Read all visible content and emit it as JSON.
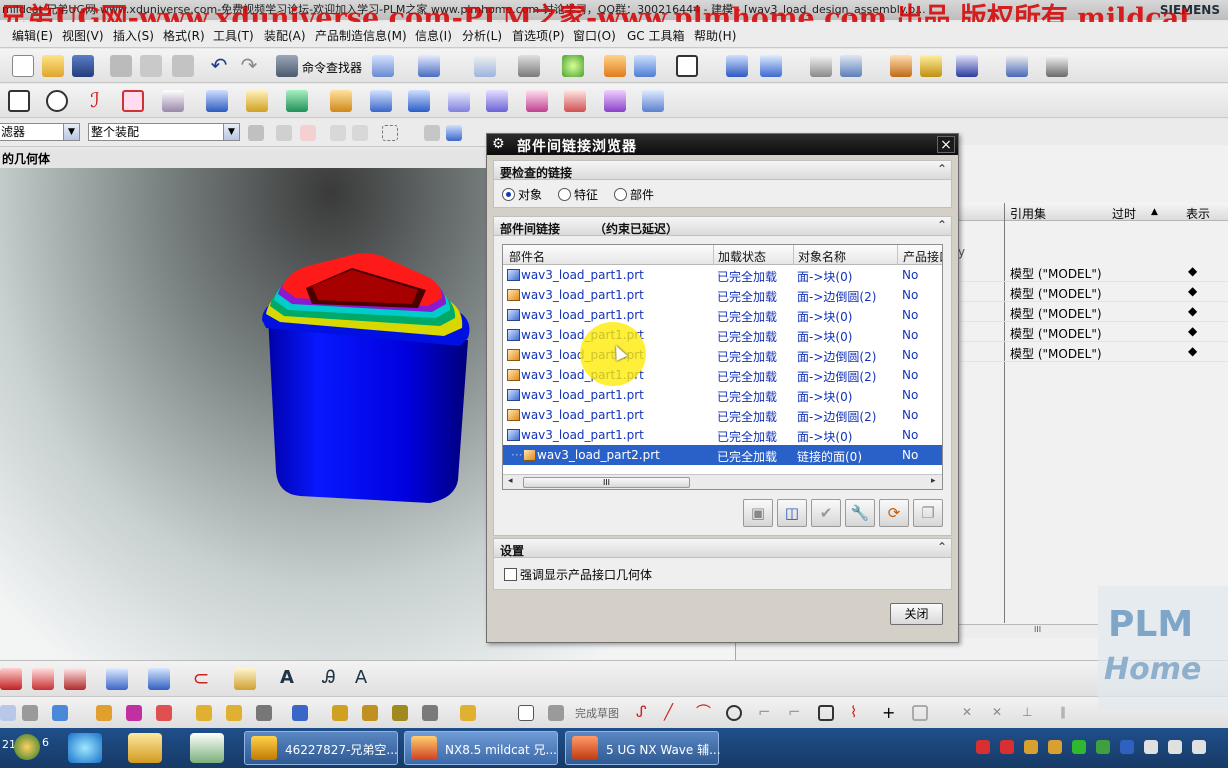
{
  "window": {
    "title": "mildcat 兄弟UG网-www.xduniverse.com-免费视频学习论坛-欢迎加入学习-PLM之家 www.plmhome.com 讨论学习，QQ群：300216444 - 建模 - [wav3_load_design_assembly.p...",
    "brand": "SIEMENS",
    "watermark": "兄弟UG网-www.xduniverse.com-PLM之家-www.plmhome.com 出品 版权所有 mildcat"
  },
  "menubar": [
    "编辑(E)",
    "视图(V)",
    "插入(S)",
    "格式(R)",
    "工具(T)",
    "装配(A)",
    "产品制造信息(M)",
    "信息(I)",
    "分析(L)",
    "首选项(P)",
    "窗口(O)",
    "GC 工具箱",
    "帮助(H)"
  ],
  "toolbar": {
    "command_finder": "命令查找器"
  },
  "filter_row": {
    "filter": "滤器",
    "scope": "整个装配"
  },
  "viewport": {
    "title": "的几何体"
  },
  "right_panel": {
    "headers": {
      "ref_set": "引用集",
      "outdated": "过时",
      "display": "表示"
    },
    "ghost": "y",
    "rows": [
      {
        "ref": "模型 (\"MODEL\")",
        "mark": "◆"
      },
      {
        "ref": "模型 (\"MODEL\")",
        "mark": "◆"
      },
      {
        "ref": "模型 (\"MODEL\")",
        "mark": "◆"
      },
      {
        "ref": "模型 (\"MODEL\")",
        "mark": "◆"
      },
      {
        "ref": "模型 (\"MODEL\")",
        "mark": "◆"
      }
    ],
    "scroll_grip": "III"
  },
  "dialog": {
    "title": "部件间链接浏览器",
    "close_x": "×",
    "sec1": {
      "title": "要检查的链接",
      "options": [
        "对象",
        "特征",
        "部件"
      ],
      "selected": "对象"
    },
    "sec2": {
      "title": "部件间链接",
      "note": "（约束已延迟）"
    },
    "table": {
      "columns": [
        "部件名",
        "加载状态",
        "对象名称",
        "产品接口"
      ],
      "rows": [
        {
          "part": "wav3_load_part1.prt",
          "state": "已完全加载",
          "obj": "面->块(0)",
          "pi": "No",
          "icon": "blue"
        },
        {
          "part": "wav3_load_part1.prt",
          "state": "已完全加载",
          "obj": "面->边倒圆(2)",
          "pi": "No",
          "icon": "orange"
        },
        {
          "part": "wav3_load_part1.prt",
          "state": "已完全加载",
          "obj": "面->块(0)",
          "pi": "No",
          "icon": "blue"
        },
        {
          "part": "wav3_load_part1.prt",
          "state": "已完全加载",
          "obj": "面->块(0)",
          "pi": "No",
          "icon": "blue"
        },
        {
          "part": "wav3_load_part1.prt",
          "state": "已完全加载",
          "obj": "面->边倒圆(2)",
          "pi": "No",
          "icon": "orange"
        },
        {
          "part": "wav3_load_part1.prt",
          "state": "已完全加载",
          "obj": "面->边倒圆(2)",
          "pi": "No",
          "icon": "orange"
        },
        {
          "part": "wav3_load_part1.prt",
          "state": "已完全加载",
          "obj": "面->块(0)",
          "pi": "No",
          "icon": "blue"
        },
        {
          "part": "wav3_load_part1.prt",
          "state": "已完全加载",
          "obj": "面->边倒圆(2)",
          "pi": "No",
          "icon": "orange"
        },
        {
          "part": "wav3_load_part1.prt",
          "state": "已完全加载",
          "obj": "面->块(0)",
          "pi": "No",
          "icon": "blue"
        },
        {
          "part": "wav3_load_part2.prt",
          "state": "已完全加载",
          "obj": "链接的面(0)",
          "pi": "No",
          "icon": "orange",
          "selected": true
        }
      ],
      "scroll_grip": "III"
    },
    "sec3": {
      "title": "设置",
      "checkbox": "强调显示产品接口几何体"
    },
    "close_button": "关闭"
  },
  "bottom_toolbar": {
    "sketch_label": "完成草图"
  },
  "logo": {
    "line1": "PLM",
    "line2": "Home"
  },
  "taskbar": {
    "clock": "21",
    "badge": "6",
    "tasks": [
      "46227827-兄弟空...",
      "NX8.5 mildcat 兄...",
      "5 UG NX Wave 辅..."
    ]
  },
  "colors": {
    "selection": "#2a61c9",
    "link_text": "#1433b8",
    "watermark": "#d80000",
    "taskbar": "#1f4f8a"
  }
}
